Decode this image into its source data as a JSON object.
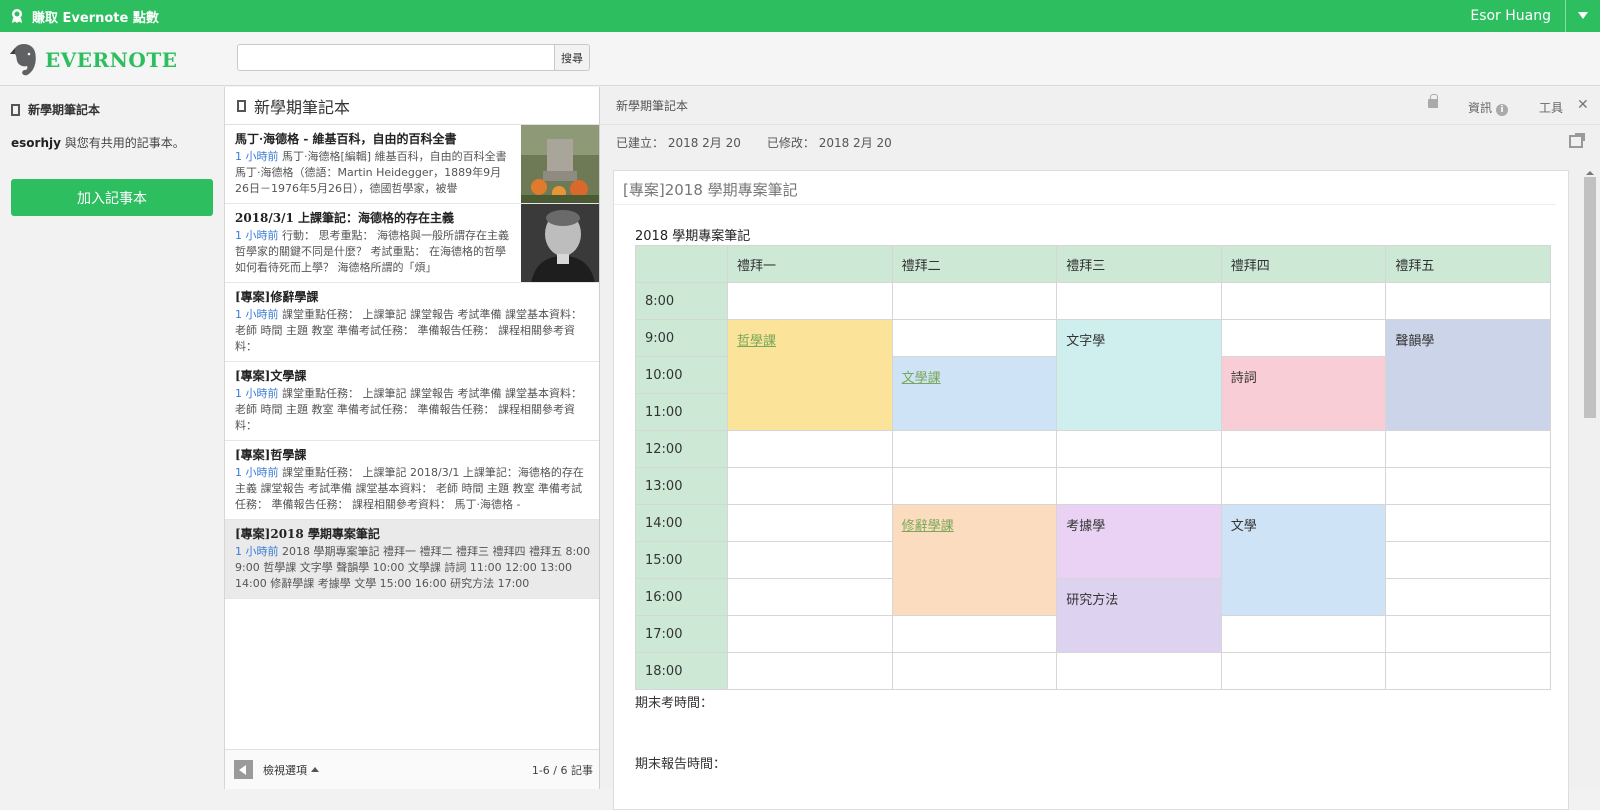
{
  "topbar": {
    "earn_label": "賺取 Evernote 點數",
    "user_name": "Esor Huang"
  },
  "header": {
    "logo_text": "EVERNOTE",
    "search_placeholder": "",
    "search_button": "搜尋"
  },
  "sidebar": {
    "notebook_title": "新學期筆記本",
    "shared_user": "esorhjy",
    "shared_suffix": " 與您有共用的記事本。",
    "join_button": "加入記事本"
  },
  "notelist": {
    "title": "新學期筆記本",
    "notes": [
      {
        "title": "馬丁·海德格 - 維基百科，自由的百科全書",
        "time": "1 小時前",
        "snippet": " 馬丁·海德格[編輯] 維基百科，自由的百科全書 馬丁·海德格（德語：Martin Heidegger，1889年9月26日－1976年5月26日），德國哲學家，被譽"
      },
      {
        "title": "2018/3/1 上課筆記：海德格的存在主義",
        "time": "1 小時前",
        "snippet": " 行動： 思考重點： 海德格與一般所謂存在主義哲學家的關鍵不同是什麼？ 考試重點： 在海德格的哲學如何看待死而上學？ 海德格所謂的「煩」"
      },
      {
        "title": "[專案]修辭學課",
        "time": "1 小時前",
        "snippet": " 課堂重點任務： 上課筆記 課堂報告 考試準備 課堂基本資料： 老師 時間 主題 教室 準備考試任務： 準備報告任務： 課程相關參考資料："
      },
      {
        "title": "[專案]文學課",
        "time": "1 小時前",
        "snippet": " 課堂重點任務： 上課筆記 課堂報告 考試準備 課堂基本資料： 老師 時間 主題 教室 準備考試任務： 準備報告任務： 課程相關參考資料："
      },
      {
        "title": "[專案]哲學課",
        "time": "1 小時前",
        "snippet": " 課堂重點任務： 上課筆記 2018/3/1 上課筆記：海德格的存在主義 課堂報告 考試準備 課堂基本資料： 老師 時間 主題 教室 準備考試任務： 準備報告任務： 課程相關參考資料： 馬丁·海德格 -"
      },
      {
        "title": "[專案]2018 學期專案筆記",
        "time": "1 小時前",
        "snippet": " 2018 學期專案筆記 禮拜一 禮拜二 禮拜三 禮拜四 禮拜五 8:00 9:00 哲學課 文字學 聲韻學 10:00 文學課 詩詞 11:00 12:00 13:00 14:00 修辭學課 考據學 文學 15:00 16:00 研究方法 17:00"
      }
    ],
    "footer_view": "檢視選項",
    "footer_count": "1-6 / 6 記事"
  },
  "editor": {
    "notebook": "新學期筆記本",
    "info_label": "資訊",
    "info_icon": "i",
    "tools_label": "工具",
    "close_glyph": "✕",
    "created": "已建立： 2018 2月 20",
    "modified": "已修改： 2018 2月 20",
    "note_title": "[專案]2018 學期專案筆記",
    "caption": "2018 學期專案筆記",
    "days": [
      "禮拜一",
      "禮拜二",
      "禮拜三",
      "禮拜四",
      "禮拜五"
    ],
    "times": [
      "8:00",
      "9:00",
      "10:00",
      "11:00",
      "12:00",
      "13:00",
      "14:00",
      "15:00",
      "16:00",
      "17:00",
      "18:00"
    ],
    "classes": {
      "mon_philosophy": "哲學課",
      "tue_literature": "文學課",
      "wed_philology": "文字學",
      "thu_poetry": "詩詞",
      "fri_phonology": "聲韻學",
      "tue_rhetoric": "修辭學課",
      "wed_textual": "考據學",
      "thu_literature": "文學",
      "wed_research": "研究方法"
    },
    "final_exam": "期末考時間：",
    "final_report": "期末報告時間："
  }
}
